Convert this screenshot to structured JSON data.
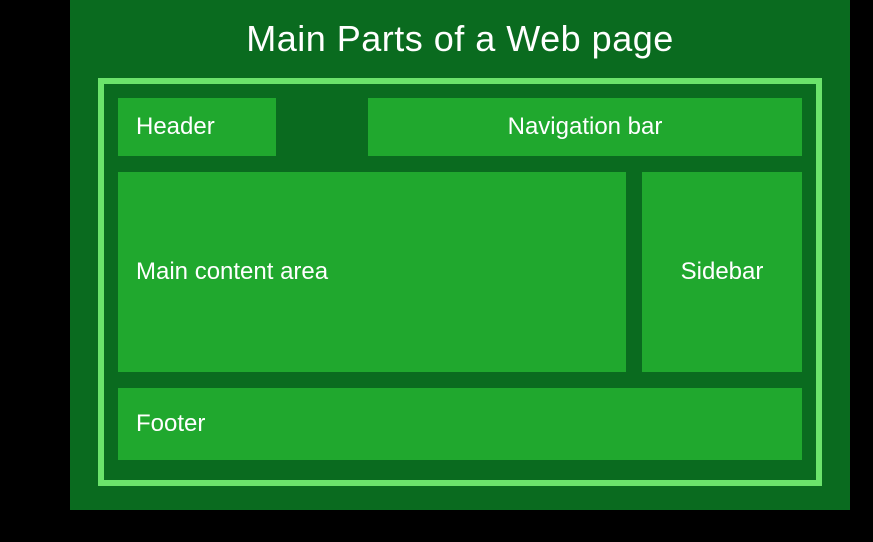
{
  "title": "Main Parts of a Web page",
  "sections": {
    "header": "Header",
    "navigation": "Navigation bar",
    "main": "Main content area",
    "sidebar": "Sidebar",
    "footer": "Footer"
  }
}
